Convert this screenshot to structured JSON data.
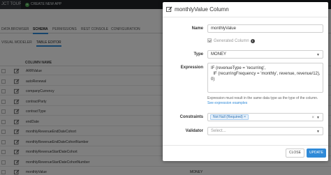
{
  "topbar": {
    "project_label": "JCT TOUR",
    "create_label": "CREATE NEW APP"
  },
  "tabs": [
    {
      "label": "DATA BROWSER"
    },
    {
      "label": "SCHEMA"
    },
    {
      "label": "PERMISSIONS"
    },
    {
      "label": "REST CONSOLE"
    },
    {
      "label": "CONFIGURATION"
    }
  ],
  "subtabs": [
    {
      "label": "VISUAL MODELER"
    },
    {
      "label": "TABLE EDITOR"
    }
  ],
  "table": {
    "column_header": "COLUMN NAME",
    "rows": [
      {
        "name": "ARRValue",
        "type": ""
      },
      {
        "name": "autoRenewal",
        "type": ""
      },
      {
        "name": "companyCurrency",
        "type": ""
      },
      {
        "name": "contractParty",
        "type": ""
      },
      {
        "name": "contractType",
        "type": ""
      },
      {
        "name": "endDate",
        "type": ""
      },
      {
        "name": "monthlyRevenueEndDateCohort",
        "type": ""
      },
      {
        "name": "monthlyRevenueEndDateCohortNumber",
        "type": ""
      },
      {
        "name": "monthlyRevenueStartDateCohort",
        "type": ""
      },
      {
        "name": "monthlyRevenueStartDateCohortNumber",
        "type": ""
      },
      {
        "name": "monthlyValue",
        "type": "MONEY"
      }
    ]
  },
  "modal": {
    "title": "monthlyValue Column",
    "name_label": "Name",
    "name_value": "monthlyValue",
    "generated_label": "Generated Column",
    "type_label": "Type",
    "type_value": "MONEY",
    "expression_label": "Expression",
    "expression_lines": [
      "IF (revenueType = 'recurring',",
      "  IF (recurringFrequency = 'monthly', revenue, revenue/12),",
      "0)"
    ],
    "expression_hint": "Expression must result in the same data type as the type of the column.",
    "expression_link": "See expression examples",
    "constraints_label": "Constraints",
    "constraint_tag": "Not Null (Required)",
    "validator_label": "Validator",
    "validator_placeholder": "Select...",
    "close_label": "CLOSE",
    "update_label": "UPDATE"
  },
  "colors": {
    "accent": "#2f8ad8",
    "topbar": "#202327",
    "overlay": "rgba(0,0,0,0.5)"
  }
}
